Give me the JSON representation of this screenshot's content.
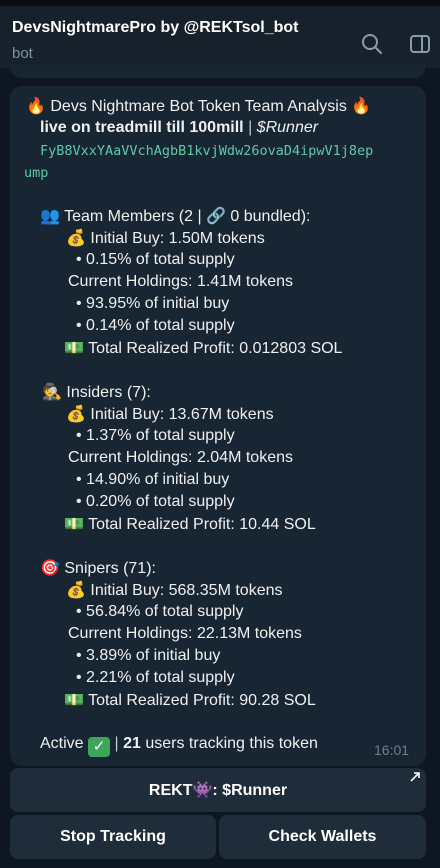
{
  "header": {
    "title": "DevsNightmarePro by @REKTsol_bot",
    "subtitle": "bot"
  },
  "message": {
    "title_line": "Devs Nightmare Bot Token Team Analysis",
    "token_name": "live on treadmill till 100mill",
    "separator": "|",
    "ticker": "$Runner",
    "contract_part1": "FyB8VxxYAaVVchAgbB1kvjWdw26ovaD4ipwV1j8ep",
    "contract_part2": "ump",
    "team": {
      "header": "Team Members (2 | 🔗 0 bundled):",
      "initial_buy": "Initial Buy: 1.50M tokens",
      "pct_supply": "• 0.15% of total supply",
      "current_holdings": "Current Holdings: 1.41M tokens",
      "pct_initial": "• 93.95% of initial buy",
      "pct_supply2": "• 0.14% of total supply",
      "profit": "Total Realized Profit: 0.012803 SOL"
    },
    "insiders": {
      "header": "Insiders (7):",
      "initial_buy": "Initial Buy: 13.67M tokens",
      "pct_supply": "• 1.37% of total supply",
      "current_holdings": "Current Holdings: 2.04M tokens",
      "pct_initial": "• 14.90% of initial buy",
      "pct_supply2": "• 0.20% of total supply",
      "profit": "Total Realized Profit: 10.44 SOL"
    },
    "snipers": {
      "header": "Snipers (71):",
      "initial_buy": "Initial Buy: 568.35M tokens",
      "pct_supply": "• 56.84% of total supply",
      "current_holdings": "Current Holdings: 22.13M tokens",
      "pct_initial": "• 3.89% of initial buy",
      "pct_supply2": "• 2.21% of total supply",
      "profit": "Total Realized Profit: 90.28 SOL"
    },
    "active_label": "Active",
    "users_count": "21",
    "users_text": "users tracking this token",
    "time": "16:01"
  },
  "keyboard": {
    "link_button": "REKT👾: $Runner",
    "stop_button": "Stop Tracking",
    "wallets_button": "Check Wallets"
  },
  "icons": {
    "fire": "🔥",
    "team": "👥",
    "money_bag": "💰",
    "cash": "💵",
    "insider": "🕵",
    "target": "🎯"
  },
  "colors": {
    "background": "#0e1621",
    "header": "#17212b",
    "bubble": "#182533",
    "button": "#1f2c3a",
    "contract": "#5fc9a8",
    "check": "#3ea65a"
  }
}
